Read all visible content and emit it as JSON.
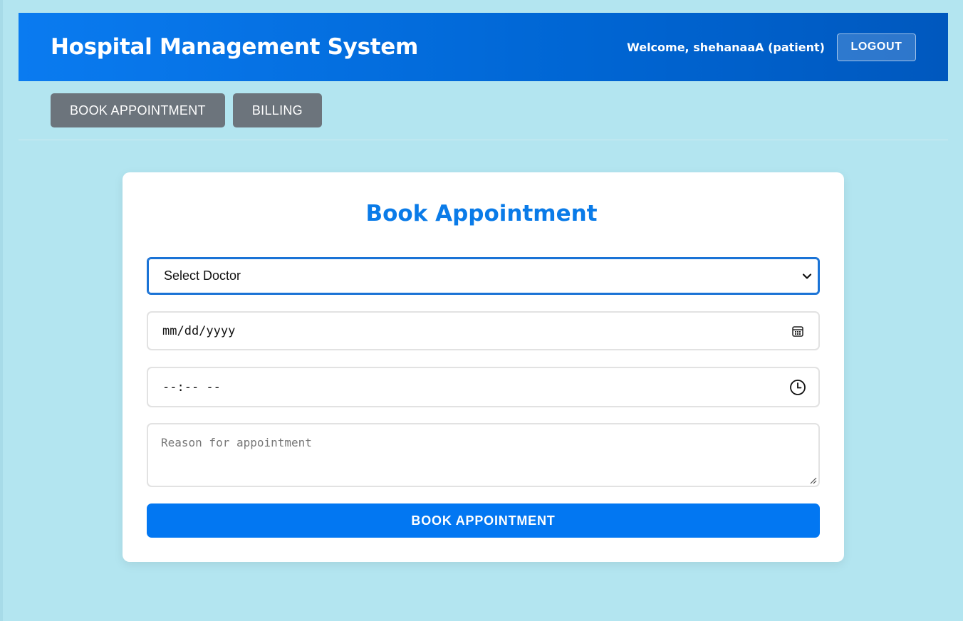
{
  "header": {
    "title": "Hospital Management System",
    "welcome": "Welcome, shehanaaA (patient)",
    "logout_label": "LOGOUT"
  },
  "nav": {
    "items": [
      {
        "label": "BOOK APPOINTMENT"
      },
      {
        "label": "BILLING"
      }
    ]
  },
  "form": {
    "title": "Book Appointment",
    "doctor_select": {
      "selected": "Select Doctor"
    },
    "date_field": {
      "placeholder": "mm/dd/yyyy"
    },
    "time_field": {
      "placeholder": "--:-- --"
    },
    "reason_field": {
      "placeholder": "Reason for appointment"
    },
    "submit_label": "BOOK APPOINTMENT"
  },
  "icons": {
    "date": "calendar-icon",
    "time": "clock-icon",
    "select": "chevron-down-icon",
    "resize": "resize-handle-icon"
  },
  "colors": {
    "background": "#b3e5f0",
    "header": "#0066d4",
    "nav_button": "#6c747c",
    "accent": "#0277f2",
    "title": "#0a7be8"
  }
}
